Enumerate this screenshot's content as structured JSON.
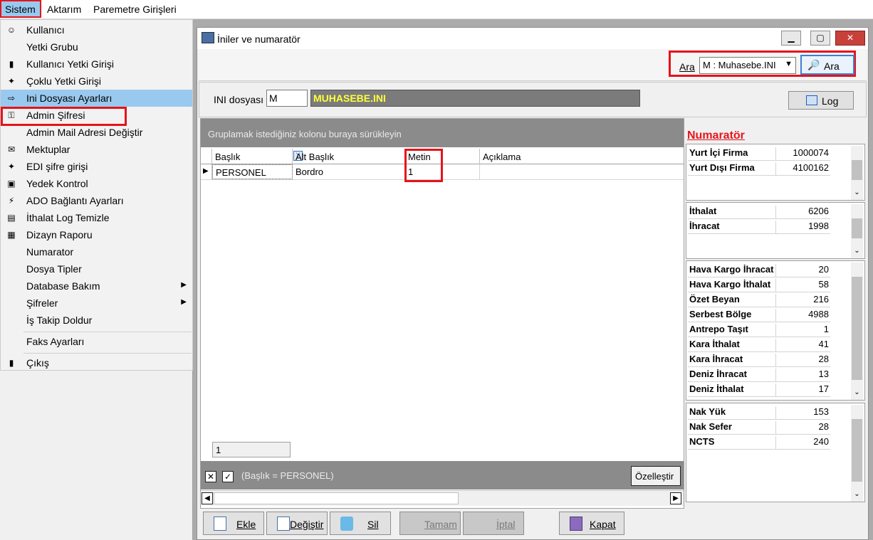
{
  "menubar": {
    "items": [
      "Sistem",
      "Aktarım",
      "Paremetre Girişleri"
    ]
  },
  "dropdown": {
    "items": [
      {
        "label": "Kullanıcı",
        "icon": "user-icon"
      },
      {
        "label": "Yetki Grubu",
        "icon": ""
      },
      {
        "label": "Kullanıcı Yetki Girişi",
        "icon": "lock-icon"
      },
      {
        "label": "Çoklu Yetki Girişi",
        "icon": "keys-icon"
      },
      {
        "label": "Ini Dosyası  Ayarları",
        "icon": "ini-icon",
        "selected": true
      },
      {
        "label": "Admin Şifresi",
        "icon": "key-icon"
      },
      {
        "label": "Admin Mail Adresi Değiştir",
        "icon": ""
      },
      {
        "label": "Mektuplar",
        "icon": "letter-icon"
      },
      {
        "label": "EDI şifre girişi",
        "icon": "keys-icon"
      },
      {
        "label": "Yedek Kontrol",
        "icon": "backup-icon"
      },
      {
        "label": "ADO Bağlantı Ayarları",
        "icon": "plug-icon"
      },
      {
        "label": "İthalat Log Temizle",
        "icon": "clean-icon"
      },
      {
        "label": "Dizayn Raporu",
        "icon": "report-icon"
      },
      {
        "label": "Numarator",
        "icon": ""
      },
      {
        "label": "Dosya Tipler",
        "icon": ""
      },
      {
        "label": "Database Bakım",
        "icon": "",
        "submenu": true
      },
      {
        "label": "Şifreler",
        "icon": "",
        "submenu": true
      },
      {
        "label": "İş Takip Doldur",
        "icon": ""
      },
      {
        "label": "Faks Ayarları",
        "icon": ""
      },
      {
        "label": "Çıkış",
        "icon": "exit-icon"
      }
    ]
  },
  "window": {
    "title": "İniler ve numaratör",
    "search": {
      "label": "Ara",
      "selected": "M : Muhasebe.INI",
      "button": "Ara"
    },
    "ini": {
      "label": "INI dosyası",
      "code": "M",
      "name": "MUHASEBE.INI",
      "log_button": "Log"
    },
    "grid": {
      "group_hint": "Gruplamak istediğiniz kolonu buraya sürükleyin",
      "columns": [
        "Başlık",
        "Alt Başlık",
        "Metin",
        "Açıklama"
      ],
      "rows": [
        [
          "PERSONEL",
          "Bordro",
          "1",
          ""
        ]
      ],
      "footer_count": "1",
      "filter_text": "(Başlık = PERSONEL)",
      "customize_button": "Özelleştir"
    },
    "numarator": {
      "title": "Numaratör",
      "panels": [
        [
          [
            "Yurt İçi Firma",
            "1000074"
          ],
          [
            "Yurt Dışı Firma",
            "4100162"
          ]
        ],
        [
          [
            "İthalat",
            "6206"
          ],
          [
            "İhracat",
            "1998"
          ]
        ],
        [
          [
            "Hava Kargo İhracat",
            "20"
          ],
          [
            "Hava Kargo İthalat",
            "58"
          ],
          [
            "Özet Beyan",
            "216"
          ],
          [
            "Serbest Bölge",
            "4988"
          ],
          [
            "Antrepo Taşıt",
            "1"
          ],
          [
            "Kara İthalat",
            "41"
          ],
          [
            "Kara İhracat",
            "28"
          ],
          [
            "Deniz İhracat",
            "13"
          ],
          [
            "Deniz İthalat",
            "17"
          ]
        ],
        [
          [
            "Nak Yük",
            "153"
          ],
          [
            "Nak Sefer",
            "28"
          ],
          [
            "NCTS",
            "240"
          ]
        ]
      ]
    },
    "buttons": {
      "ekle": "Ekle",
      "degistir": "Değiştir",
      "sil": "Sil",
      "tamam": "Tamam",
      "iptal": "İptal",
      "kapat": "Kapat"
    }
  }
}
